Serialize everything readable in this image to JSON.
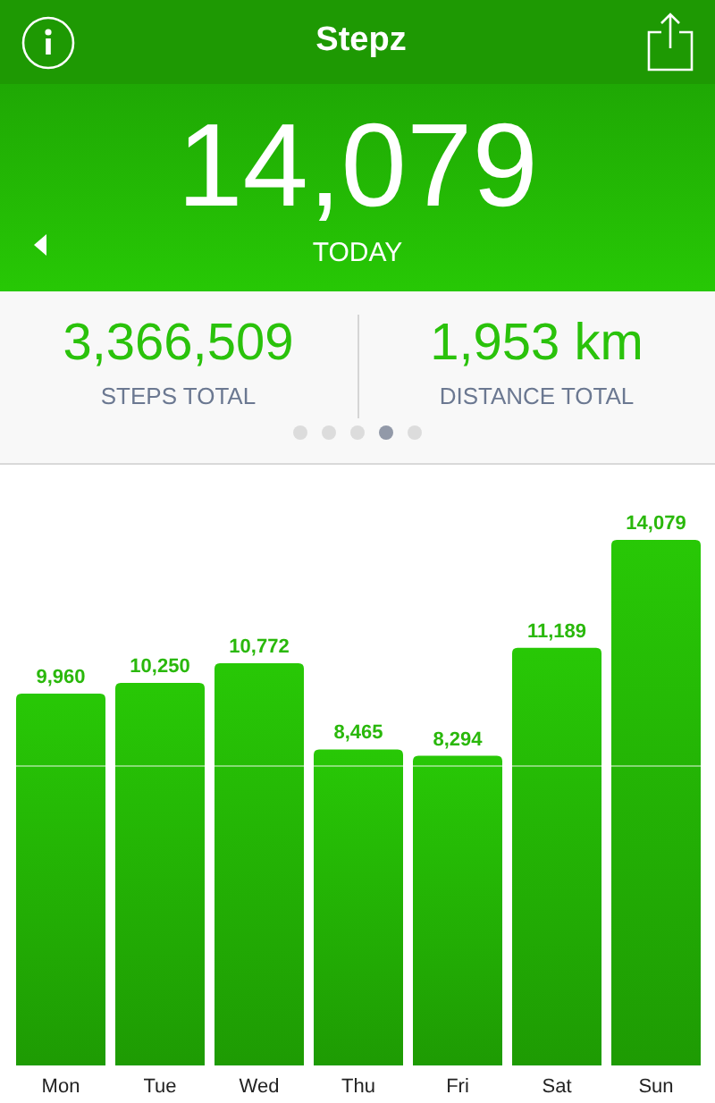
{
  "header": {
    "title": "Stepz"
  },
  "today": {
    "steps": "14,079",
    "label": "TODAY"
  },
  "stats": [
    {
      "value": "3,366,509",
      "label": "STEPS TOTAL"
    },
    {
      "value": "1,953 km",
      "label": "DISTANCE TOTAL"
    }
  ],
  "pages": [
    {
      "selected": false
    },
    {
      "selected": false
    },
    {
      "selected": false
    },
    {
      "selected": true
    },
    {
      "selected": false
    }
  ],
  "chart": {
    "chart_data": {
      "type": "bar",
      "categories": [
        "Mon",
        "Tue",
        "Wed",
        "Thu",
        "Fri",
        "Sat",
        "Sun"
      ],
      "values": [
        9960,
        10250,
        10772,
        8465,
        8294,
        11189,
        14079
      ],
      "value_labels": [
        "9,960",
        "10,250",
        "10,772",
        "8,465",
        "8,294",
        "11,189",
        "14,079"
      ]
    }
  }
}
